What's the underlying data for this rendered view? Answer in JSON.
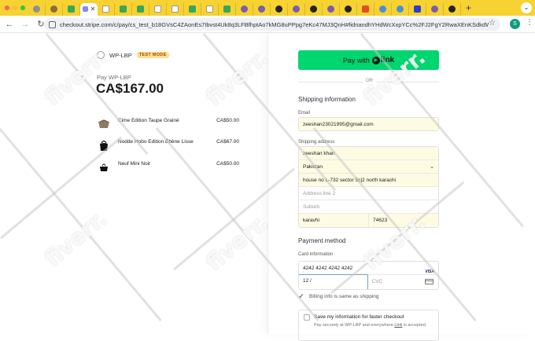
{
  "browser": {
    "url": "checkout.stripe.com/c/pay/cs_test_b18GVsC4ZAonEs7Ibvst4Uk8q3LFBfhptAo7kMG8uPPpg7eKc47MJ3QnH#fidnandhYHdWcXxpYCc%2FJ2FgY2RwaXEnKSdkdWxOYHwnP...",
    "tabs_count": 24,
    "profile_initial": "S"
  },
  "merchant": {
    "name": "WP-LBP",
    "test_badge": "TEST MODE",
    "pay_label": "Pay WP-LBP",
    "amount": "CA$167.00"
  },
  "line_items": [
    {
      "name": "Cime Edition Taupe Grainé",
      "price": "CA$50.00"
    },
    {
      "name": "Nodde Hobo Edition Ébène Lisse",
      "price": "CA$67.00"
    },
    {
      "name": "Neuf Mini Noir",
      "price": "CA$50.00"
    }
  ],
  "checkout": {
    "pay_with_link_label": "Pay with",
    "link_brand": "link",
    "or_label": "OR",
    "shipping_title": "Shipping information",
    "email_label": "Email",
    "email_value": "zeeshan23021995@gmail.com",
    "shipping_address_label": "Shipping address",
    "address": {
      "name": "zeeshan khan",
      "country": "Pakistan",
      "line1": "house no L-732 sector 5c|2 north karachi",
      "line2_placeholder": "Address line 2",
      "suburb_placeholder": "Suburb",
      "city": "karavhi",
      "postal": "74623"
    },
    "payment_title": "Payment method",
    "card_info_label": "Card information",
    "card_number": "4242 4242 4242 4242",
    "card_brand": "VISA",
    "expiry": "12 /",
    "cvc_placeholder": "CVC",
    "billing_same_label": "Billing info is same as shipping",
    "save_title": "Save my information for faster checkout",
    "save_desc_prefix": "Pay securely at WP-LBP and everywhere ",
    "save_desc_link": "Link",
    "save_desc_suffix": " is accepted."
  },
  "watermark": "fiverr.",
  "colors": {
    "link_green": "#00d66f",
    "autofill_yellow": "#fefbe3",
    "badge_bg": "#ffde92",
    "badge_text": "#a04a00",
    "tabstrip": "#f6d232",
    "focus_blue": "#6ea3c8"
  }
}
